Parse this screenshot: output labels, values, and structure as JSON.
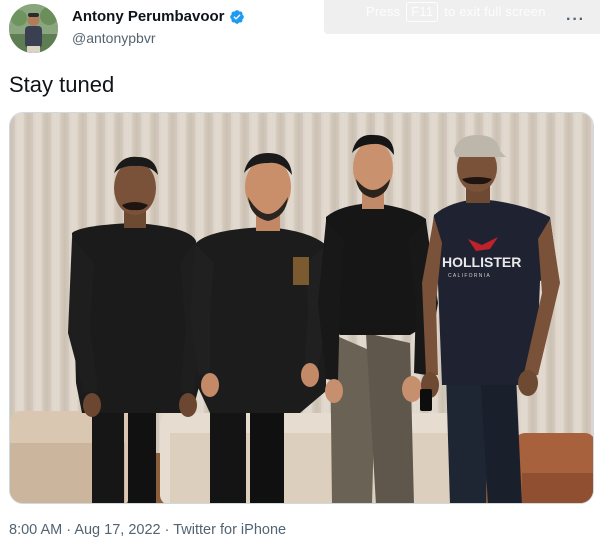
{
  "overlay": {
    "press": "Press",
    "key": "F11",
    "rest": "to exit full screen"
  },
  "tweet": {
    "display_name": "Antony Perumbavoor",
    "handle": "@antonypbvr",
    "text": "Stay tuned",
    "time": "8:00 AM",
    "date": "Aug 17, 2022",
    "source": "Twitter for iPhone",
    "separator": "·",
    "more": "···"
  },
  "photo": {
    "shirt_text": "HOLLISTER",
    "shirt_subtext": "CALIFORNIA"
  },
  "colors": {
    "verified": "#1d9bf0",
    "secondary_text": "#536471",
    "primary_text": "#0f1419"
  },
  "icons": {
    "verified": "verified-badge-icon",
    "more": "more-options-icon"
  }
}
